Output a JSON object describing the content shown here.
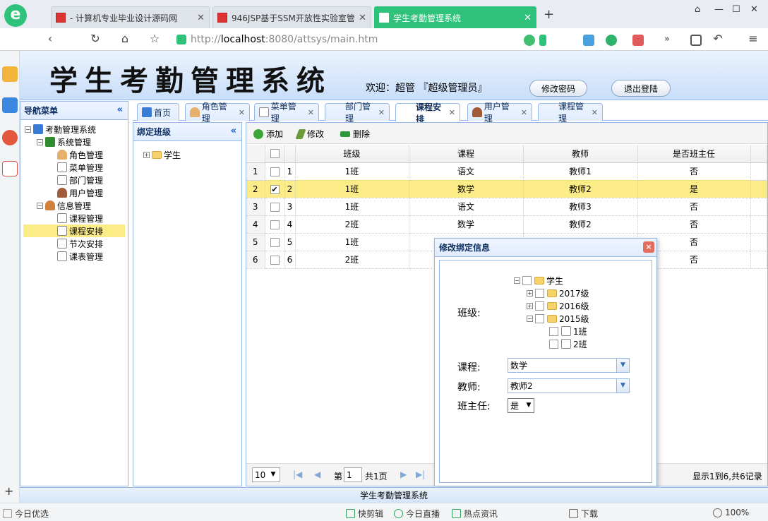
{
  "browser": {
    "tabs": [
      {
        "label": "- 计算机专业毕业设计源码网"
      },
      {
        "label": "946JSP基于SSM开放性实验室管"
      },
      {
        "label": "学生考勤管理系统"
      }
    ],
    "new_tab": "+",
    "url_protocol": "http://",
    "url_host": "localhost",
    "url_path": ":8080/attsys/main.htm"
  },
  "app": {
    "title": "学生考勤管理系统",
    "welcome": "欢迎：超管 『超级管理员』",
    "change_password": "修改密码",
    "logout": "退出登陆",
    "footer": "学生考勤管理系统"
  },
  "nav": {
    "title": "导航菜单",
    "collapse": "«",
    "root": "考勤管理系统",
    "groups": [
      {
        "label": "系统管理",
        "items": [
          "角色管理",
          "菜单管理",
          "部门管理",
          "用户管理"
        ]
      },
      {
        "label": "信息管理",
        "items": [
          "课程管理",
          "课程安排",
          "节次安排",
          "课表管理"
        ]
      }
    ]
  },
  "page_tabs": [
    "首页",
    "角色管理",
    "菜单管理",
    "部门管理",
    "课程安排",
    "用户管理",
    "课程管理"
  ],
  "bind_panel": {
    "title": "绑定班级",
    "collapse": "«",
    "root": "学生"
  },
  "toolbar": {
    "add": "添加",
    "edit": "修改",
    "delete": "删除"
  },
  "grid": {
    "columns": [
      "班级",
      "课程",
      "教师",
      "是否班主任"
    ],
    "rows": [
      {
        "rn": "1",
        "id": "1",
        "class": "1班",
        "course": "语文",
        "teacher": "教师1",
        "head": "否",
        "checked": false
      },
      {
        "rn": "2",
        "id": "2",
        "class": "1班",
        "course": "数学",
        "teacher": "教师2",
        "head": "是",
        "checked": true
      },
      {
        "rn": "3",
        "id": "3",
        "class": "1班",
        "course": "语文",
        "teacher": "教师3",
        "head": "否",
        "checked": false
      },
      {
        "rn": "4",
        "id": "4",
        "class": "2班",
        "course": "数学",
        "teacher": "教师2",
        "head": "否",
        "checked": false
      },
      {
        "rn": "5",
        "id": "5",
        "class": "1班",
        "course": "",
        "teacher": "",
        "head": "否",
        "checked": false
      },
      {
        "rn": "6",
        "id": "6",
        "class": "2班",
        "course": "",
        "teacher": "",
        "head": "否",
        "checked": false
      }
    ]
  },
  "pager": {
    "page_size": "10",
    "page_prefix": "第",
    "page": "1",
    "page_total": "共1页",
    "summary": "显示1到6,共6记录"
  },
  "dialog": {
    "title": "修改绑定信息",
    "close": "×",
    "class_label": "班级:",
    "tree_root": "学生",
    "grades": [
      "2017级",
      "2016级",
      "2015级"
    ],
    "classes": [
      "1班",
      "2班"
    ],
    "course_label": "课程:",
    "course_value": "数学",
    "teacher_label": "教师:",
    "teacher_value": "教师2",
    "head_label": "班主任:",
    "head_value": "是"
  },
  "statusbar": {
    "left": "今日优选",
    "items": [
      "快剪辑",
      "今日直播",
      "热点资讯",
      "下载"
    ],
    "zoom": "100%"
  }
}
